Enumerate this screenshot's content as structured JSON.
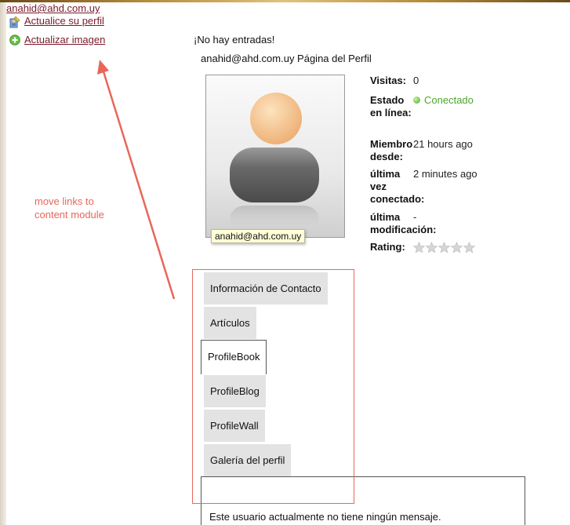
{
  "sidebar": {
    "user_email": "anahid@ahd.com.uy",
    "edit_profile_label": "Actualice su perfil",
    "update_image_label": "Actualizar imagen"
  },
  "main": {
    "no_entries": "¡No hay entradas!",
    "profile_title": "anahid@ahd.com.uy Página del Perfil",
    "avatar_tooltip": "anahid@ahd.com.uy"
  },
  "info": {
    "visits_label": "Visitas:",
    "visits_value": "0",
    "status_label": "Estado en línea:",
    "status_value": "Conectado",
    "member_since_label": "Miembro desde:",
    "member_since_value": "21 hours ago",
    "last_connected_label": "última vez conectado:",
    "last_connected_value": "2 minutes ago",
    "last_modified_label": "última modificación:",
    "last_modified_value": "-",
    "rating_label": "Rating:",
    "rating_value": 0,
    "rating_max": 5
  },
  "tabs": [
    {
      "label": "Información de Contacto",
      "active": false
    },
    {
      "label": "Artículos",
      "active": false
    },
    {
      "label": "ProfileBook",
      "active": true
    },
    {
      "label": "ProfileBlog",
      "active": false
    },
    {
      "label": "ProfileWall",
      "active": false
    },
    {
      "label": "Galería del perfil",
      "active": false
    }
  ],
  "content": {
    "no_messages": "Este usuario actualmente no tiene ningún mensaje."
  },
  "annotation": {
    "line1": "move links to",
    "line2": "content module"
  },
  "colors": {
    "link": "#7a1a2a",
    "annotation": "#e8675a",
    "online": "#4aa82a",
    "tab_bg": "#e3e3e3"
  }
}
